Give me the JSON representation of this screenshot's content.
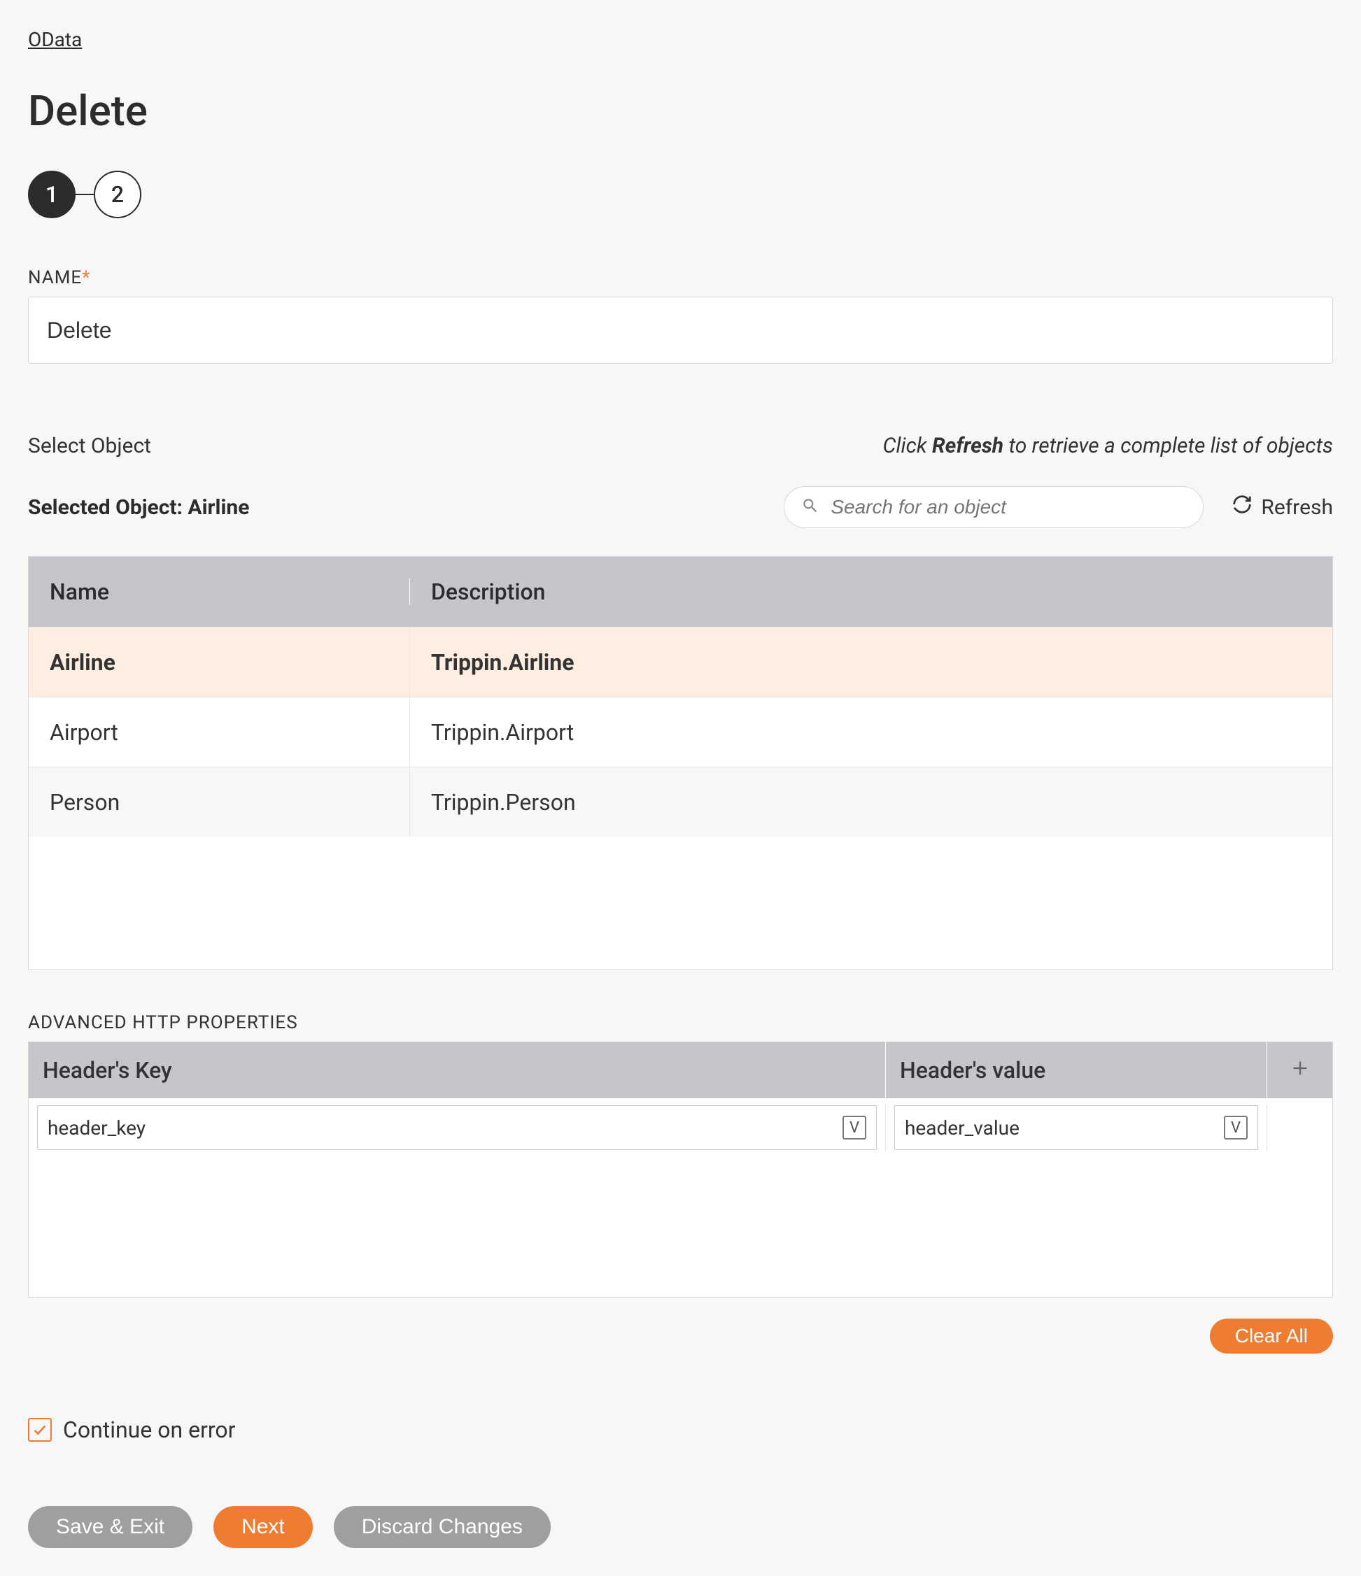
{
  "breadcrumb": "OData",
  "page_title": "Delete",
  "stepper": {
    "steps": [
      "1",
      "2"
    ],
    "active": 0
  },
  "name_field": {
    "label": "NAME",
    "required": "*",
    "value": "Delete"
  },
  "object": {
    "select_label": "Select Object",
    "hint_prefix": "Click ",
    "hint_bold": "Refresh",
    "hint_suffix": " to retrieve a complete list of objects",
    "selected_label": "Selected Object:",
    "selected_value": "Airline",
    "search_placeholder": "Search for an object",
    "refresh_label": "Refresh",
    "columns": {
      "name": "Name",
      "desc": "Description"
    },
    "rows": [
      {
        "name": "Airline",
        "desc": "Trippin.Airline",
        "selected": true
      },
      {
        "name": "Airport",
        "desc": "Trippin.Airport",
        "selected": false
      },
      {
        "name": "Person",
        "desc": "Trippin.Person",
        "selected": false
      }
    ]
  },
  "advanced": {
    "label": "ADVANCED HTTP PROPERTIES",
    "columns": {
      "key": "Header's Key",
      "value": "Header's value"
    },
    "row": {
      "key": "header_key",
      "value": "header_value"
    },
    "var_badge": "V",
    "clear_all": "Clear All"
  },
  "continue_on_error": {
    "label": "Continue on error",
    "checked": true
  },
  "footer": {
    "save_exit": "Save & Exit",
    "next": "Next",
    "discard": "Discard Changes"
  }
}
